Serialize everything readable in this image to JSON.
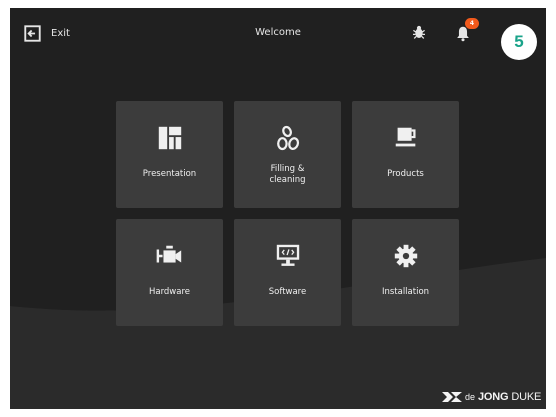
{
  "header": {
    "exit_label": "Exit",
    "title": "Welcome",
    "notification_count": "4"
  },
  "step_badge": "5",
  "tiles": [
    {
      "label": "Presentation",
      "icon": "presentation-icon"
    },
    {
      "label": "Filling &\ncleaning",
      "icon": "filling-cleaning-icon"
    },
    {
      "label": "Products",
      "icon": "cup-icon"
    },
    {
      "label": "Hardware",
      "icon": "hardware-icon"
    },
    {
      "label": "Software",
      "icon": "software-icon"
    },
    {
      "label": "Installation",
      "icon": "gear-icon"
    }
  ],
  "logo": {
    "prefix": "de",
    "name": "JONG",
    "suffix": "DUKE"
  },
  "colors": {
    "background": "#1d1d1d",
    "tile": "#3c3c3c",
    "badge": "#f25a1c",
    "step_badge_text": "#1aa38a"
  }
}
